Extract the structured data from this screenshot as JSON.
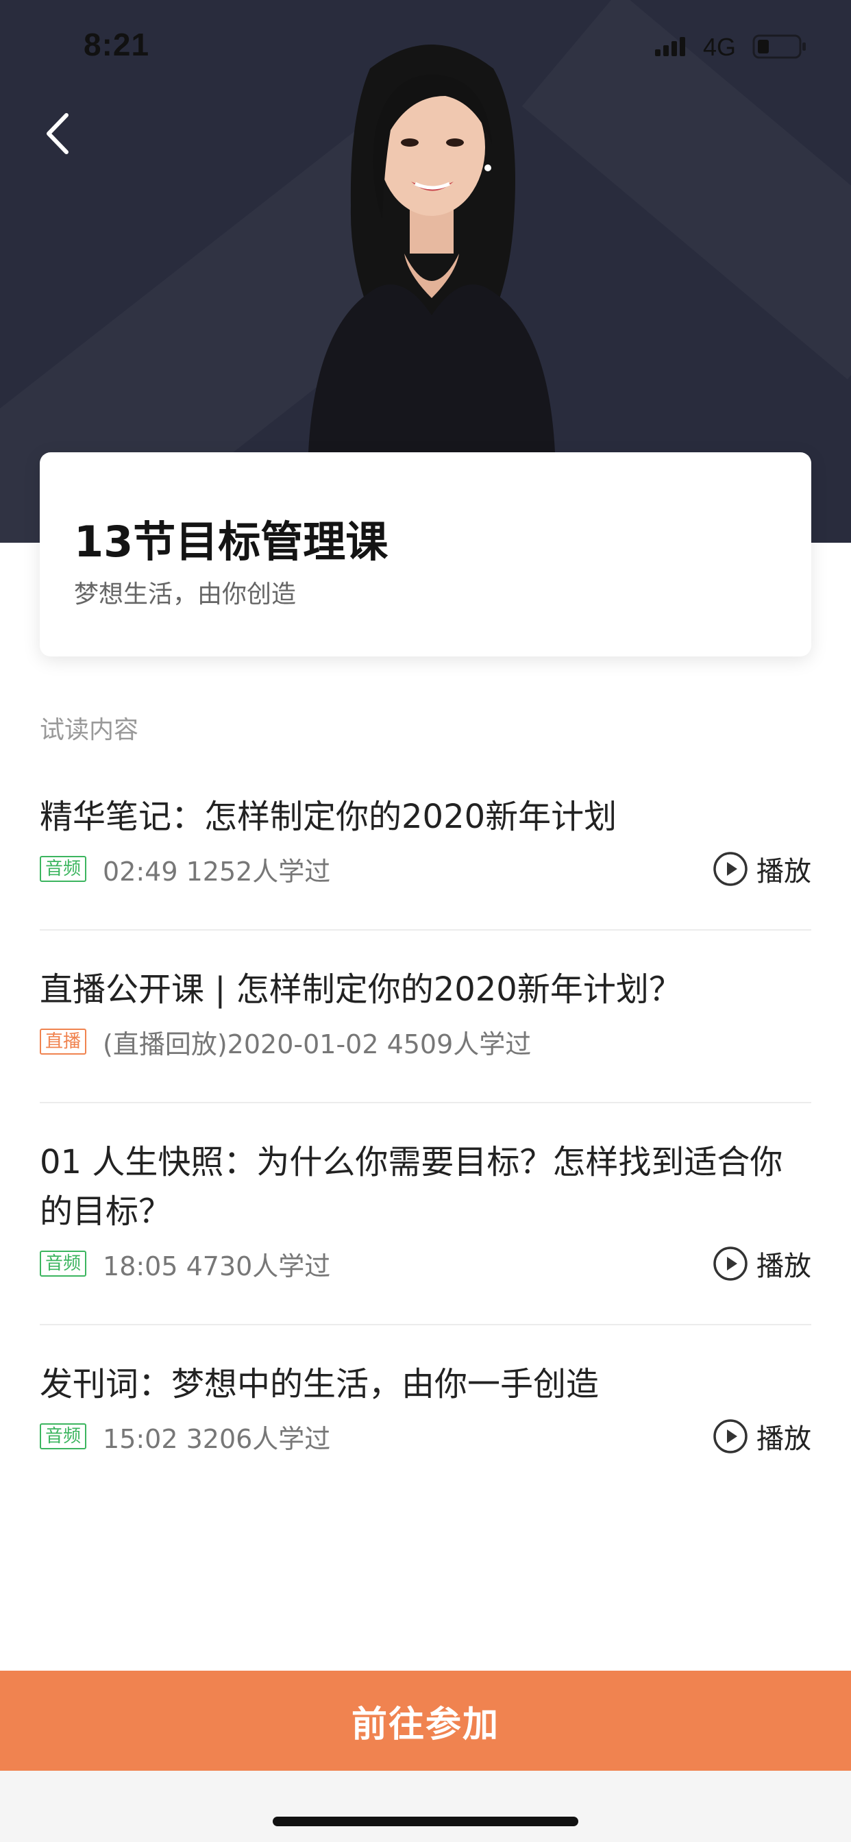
{
  "status_bar": {
    "time": "8:21",
    "network": "4G"
  },
  "course": {
    "title": "13节目标管理课",
    "subtitle": "梦想生活，由你创造"
  },
  "section": {
    "label": "试读内容"
  },
  "lessons": [
    {
      "title": "精华笔记：怎样制定你的2020新年计划",
      "tag": "音频",
      "tag_type": "audio",
      "meta": "02:49 1252人学过",
      "action": "播放"
    },
    {
      "title": "直播公开课 | 怎样制定你的2020新年计划？",
      "tag": "直播",
      "tag_type": "live",
      "meta": "(直播回放)2020-01-02 4509人学过",
      "action": ""
    },
    {
      "title": "01 人生快照：为什么你需要目标？怎样找到适合你的目标？",
      "tag": "音频",
      "tag_type": "audio",
      "meta": "18:05 4730人学过",
      "action": "播放"
    },
    {
      "title": "发刊词：梦想中的生活，由你一手创造",
      "tag": "音频",
      "tag_type": "audio",
      "meta": "15:02 3206人学过",
      "action": "播放"
    }
  ],
  "cta": {
    "label": "前往参加"
  },
  "icons": {
    "back": "chevron-left-icon",
    "play": "play-circle-icon",
    "signal": "signal-icon",
    "battery": "battery-icon"
  },
  "colors": {
    "hero_background": "#292c3d",
    "accent": "#f08350",
    "audio_tag": "#3cb55f",
    "live_tag": "#f0834f"
  }
}
